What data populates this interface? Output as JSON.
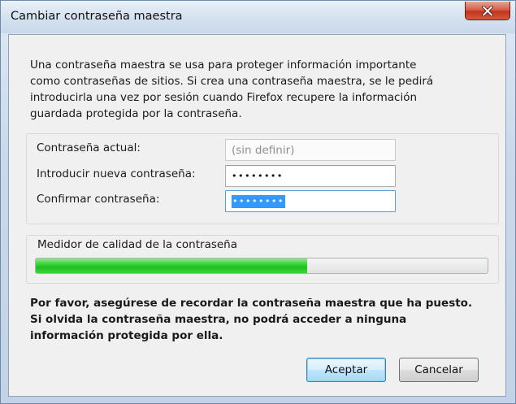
{
  "window": {
    "title": "Cambiar contraseña maestra"
  },
  "intro": {
    "lines": [
      "Una contraseña maestra se usa para proteger información importante",
      "como contraseñas de sitios. Si crea una contraseña maestra, se le pedirá",
      "introducirla una vez por sesión cuando Firefox recupere la información",
      "guardada protegida por la contraseña."
    ]
  },
  "form": {
    "current_label": "Contraseña actual:",
    "current_value": "(sin definir)",
    "new_label": "Introducir nueva contraseña:",
    "new_value": "••••••••",
    "confirm_label": "Confirmar contraseña:",
    "confirm_value": "••••••••"
  },
  "meter": {
    "label": "Medidor de calidad de la contraseña",
    "level": 0.6
  },
  "warning": {
    "lines": [
      "Por favor, asegúrese de recordar la contraseña maestra que ha puesto.",
      "Si olvida la contraseña maestra, no podrá acceder a ninguna",
      "información protegida por ella."
    ]
  },
  "buttons": {
    "accept_label": "Aceptar",
    "cancel_label": "Cancelar"
  },
  "icons": {
    "close": "close-icon"
  }
}
